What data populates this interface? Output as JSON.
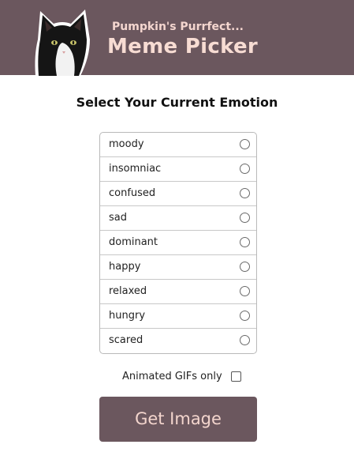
{
  "header": {
    "subtitle": "Pumpkin's Purrfect...",
    "title": "Meme Picker",
    "logo_icon": "cat-photo-icon",
    "background_color": "#6b575e",
    "text_color": "#f7dcd3"
  },
  "main": {
    "heading": "Select Your Current Emotion",
    "emotions": [
      {
        "label": "moody",
        "selected": false
      },
      {
        "label": "insomniac",
        "selected": false
      },
      {
        "label": "confused",
        "selected": false
      },
      {
        "label": "sad",
        "selected": false
      },
      {
        "label": "dominant",
        "selected": false
      },
      {
        "label": "happy",
        "selected": false
      },
      {
        "label": "relaxed",
        "selected": false
      },
      {
        "label": "hungry",
        "selected": false
      },
      {
        "label": "scared",
        "selected": false
      }
    ],
    "gifs_only": {
      "label": "Animated GIFs only",
      "checked": false
    },
    "button_label": "Get Image"
  }
}
